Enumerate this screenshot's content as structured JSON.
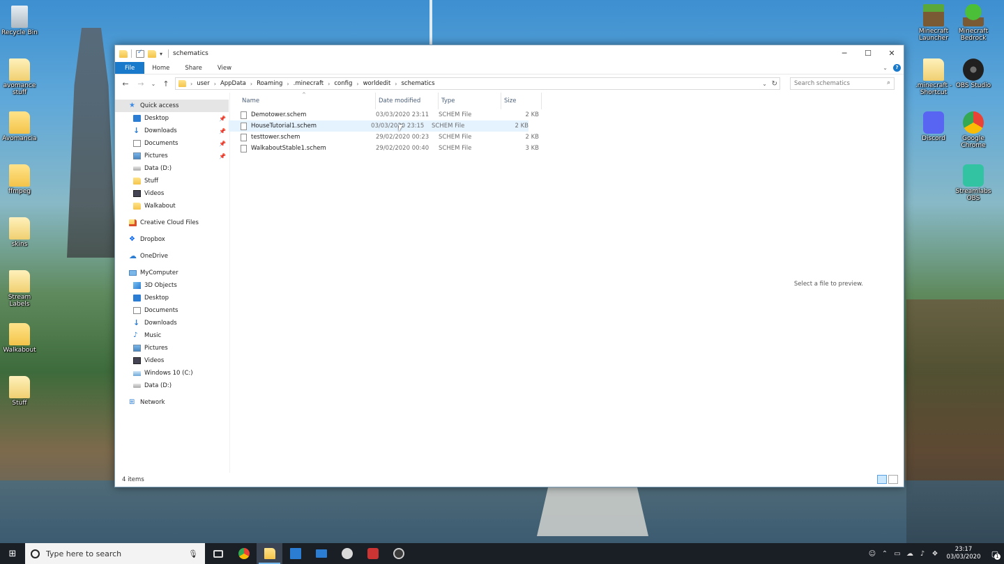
{
  "desktop": {
    "icons_left": [
      {
        "label": "Recycle Bin",
        "icon": "recycle-bin-icon"
      },
      {
        "label": "avomance stuff",
        "icon": "folder-icon"
      },
      {
        "label": "Avomancia",
        "icon": "folder-icon"
      },
      {
        "label": "ffmpeg",
        "icon": "folder-icon"
      },
      {
        "label": "skins",
        "icon": "folder-icon"
      },
      {
        "label": "Stream Labels",
        "icon": "folder-icon"
      },
      {
        "label": "Walkabout",
        "icon": "folder-icon"
      },
      {
        "label": "Stuff",
        "icon": "folder-icon"
      }
    ],
    "icons_right": [
      {
        "label": "Minecraft Launcher",
        "icon": "minecraft-icon"
      },
      {
        "label": "Minecraft Bedrock",
        "icon": "minecraft-bedrock-icon"
      },
      {
        "label": ".minecraft - Shortcut",
        "icon": "folder-shortcut-icon"
      },
      {
        "label": "OBS Studio",
        "icon": "obs-icon"
      },
      {
        "label": "Discord",
        "icon": "discord-icon"
      },
      {
        "label": "Google Chrome",
        "icon": "chrome-icon"
      },
      {
        "label": "Streamlabs OBS",
        "icon": "streamlabs-icon"
      }
    ]
  },
  "window": {
    "title": "schematics",
    "ribbon_tabs": [
      "File",
      "Home",
      "Share",
      "View"
    ],
    "address": {
      "crumbs": [
        "user",
        "AppData",
        "Roaming",
        ".minecraft",
        "config",
        "worldedit",
        "schematics"
      ]
    },
    "search": {
      "placeholder": "Search schematics"
    },
    "nav_pane": {
      "quick_access": {
        "label": "Quick access",
        "icon": "star-icon"
      },
      "quick_items": [
        {
          "label": "Desktop",
          "icon": "desktop",
          "pinned": true
        },
        {
          "label": "Downloads",
          "icon": "down",
          "pinned": true
        },
        {
          "label": "Documents",
          "icon": "docs",
          "pinned": true
        },
        {
          "label": "Pictures",
          "icon": "pics",
          "pinned": true
        },
        {
          "label": "Data (D:)",
          "icon": "drive",
          "pinned": false
        },
        {
          "label": "Stuff",
          "icon": "fold",
          "pinned": false
        },
        {
          "label": "Videos",
          "icon": "video",
          "pinned": false
        },
        {
          "label": "Walkabout",
          "icon": "fold",
          "pinned": false
        }
      ],
      "creative_cloud": "Creative Cloud Files",
      "dropbox": "Dropbox",
      "onedrive": "OneDrive",
      "computer": {
        "label": "MyComputer"
      },
      "computer_items": [
        {
          "label": "3D Objects",
          "icon": "cube"
        },
        {
          "label": "Desktop",
          "icon": "desktop"
        },
        {
          "label": "Documents",
          "icon": "docs"
        },
        {
          "label": "Downloads",
          "icon": "down"
        },
        {
          "label": "Music",
          "icon": "music"
        },
        {
          "label": "Pictures",
          "icon": "pics"
        },
        {
          "label": "Videos",
          "icon": "video"
        },
        {
          "label": "Windows 10 (C:)",
          "icon": "win"
        },
        {
          "label": "Data (D:)",
          "icon": "drive"
        }
      ],
      "network": "Network"
    },
    "columns": {
      "name": "Name",
      "date": "Date modified",
      "type": "Type",
      "size": "Size"
    },
    "files": [
      {
        "name": "Demotower.schem",
        "date": "03/03/2020 23:11",
        "type": "SCHEM File",
        "size": "2 KB"
      },
      {
        "name": "HouseTutorial1.schem",
        "date": "03/03/2020 23:15",
        "type": "SCHEM File",
        "size": "2 KB"
      },
      {
        "name": "testtower.schem",
        "date": "29/02/2020 00:23",
        "type": "SCHEM File",
        "size": "2 KB"
      },
      {
        "name": "WalkaboutStable1.schem",
        "date": "29/02/2020 00:40",
        "type": "SCHEM File",
        "size": "3 KB"
      }
    ],
    "preview_text": "Select a file to preview.",
    "status": "4 items"
  },
  "taskbar": {
    "search_placeholder": "Type here to search",
    "apps": [
      {
        "icon": "task-view-icon",
        "cls": "taskview",
        "active": false
      },
      {
        "icon": "chrome-icon",
        "cls": "chrome",
        "active": false
      },
      {
        "icon": "file-explorer-icon",
        "cls": "explorer",
        "active": true
      },
      {
        "icon": "store-icon",
        "cls": "store",
        "active": false
      },
      {
        "icon": "mail-icon",
        "cls": "mail",
        "active": false
      },
      {
        "icon": "app-icon",
        "cls": "app5",
        "active": false
      },
      {
        "icon": "streamlabs-icon",
        "cls": "app6",
        "active": false
      },
      {
        "icon": "obs-icon",
        "cls": "obs",
        "active": false
      }
    ],
    "time": "23:17",
    "date": "03/03/2020",
    "notification_count": "1"
  }
}
